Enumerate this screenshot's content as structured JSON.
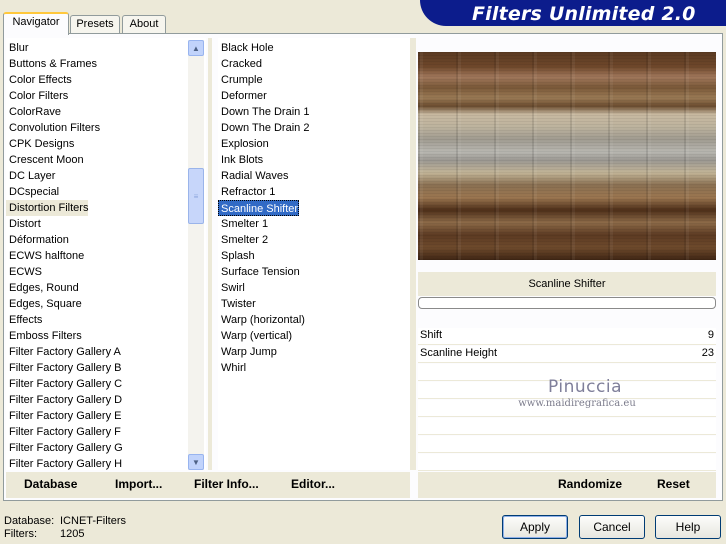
{
  "window": {
    "title": "Filters Unlimited 2.0"
  },
  "tabs": [
    {
      "label": "Navigator"
    },
    {
      "label": "Presets"
    },
    {
      "label": "About"
    }
  ],
  "categories": {
    "selected": "Distortion Filters",
    "items": [
      "Blur",
      "Buttons & Frames",
      "Color Effects",
      "Color Filters",
      "ColorRave",
      "Convolution Filters",
      "CPK Designs",
      "Crescent Moon",
      "DC Layer",
      "DCspecial",
      "Distortion Filters",
      "Distort",
      "Déformation",
      "ECWS halftone",
      "ECWS",
      "Edges, Round",
      "Edges, Square",
      "Effects",
      "Emboss Filters",
      "Filter Factory Gallery A",
      "Filter Factory Gallery B",
      "Filter Factory Gallery C",
      "Filter Factory Gallery D",
      "Filter Factory Gallery E",
      "Filter Factory Gallery F",
      "Filter Factory Gallery G",
      "Filter Factory Gallery H"
    ]
  },
  "filters": {
    "selected": "Scanline Shifter",
    "items": [
      "Black Hole",
      "Cracked",
      "Crumple",
      "Deformer",
      "Down The Drain 1",
      "Down The Drain 2",
      "Explosion",
      "Ink Blots",
      "Radial Waves",
      "Refractor 1",
      "Scanline Shifter",
      "Smelter 1",
      "Smelter 2",
      "Splash",
      "Surface Tension",
      "Swirl",
      "Twister",
      "Warp (horizontal)",
      "Warp (vertical)",
      "Warp Jump",
      "Whirl"
    ]
  },
  "preview": {
    "filter_name": "Scanline Shifter",
    "progress": 0
  },
  "params": [
    {
      "label": "Shift",
      "value": "9"
    },
    {
      "label": "Scanline Height",
      "value": "23"
    }
  ],
  "watermark": {
    "name": "Pinuccia",
    "url": "www.maidiregrafica.eu"
  },
  "toolbar": {
    "database": "Database",
    "import": "Import...",
    "filter_info": "Filter Info...",
    "editor": "Editor...",
    "randomize": "Randomize",
    "reset": "Reset"
  },
  "status": {
    "database_label": "Database:",
    "database_value": "ICNET-Filters",
    "filters_label": "Filters:",
    "filters_value": "1205"
  },
  "buttons": {
    "apply": "Apply",
    "cancel": "Cancel",
    "help": "Help"
  }
}
